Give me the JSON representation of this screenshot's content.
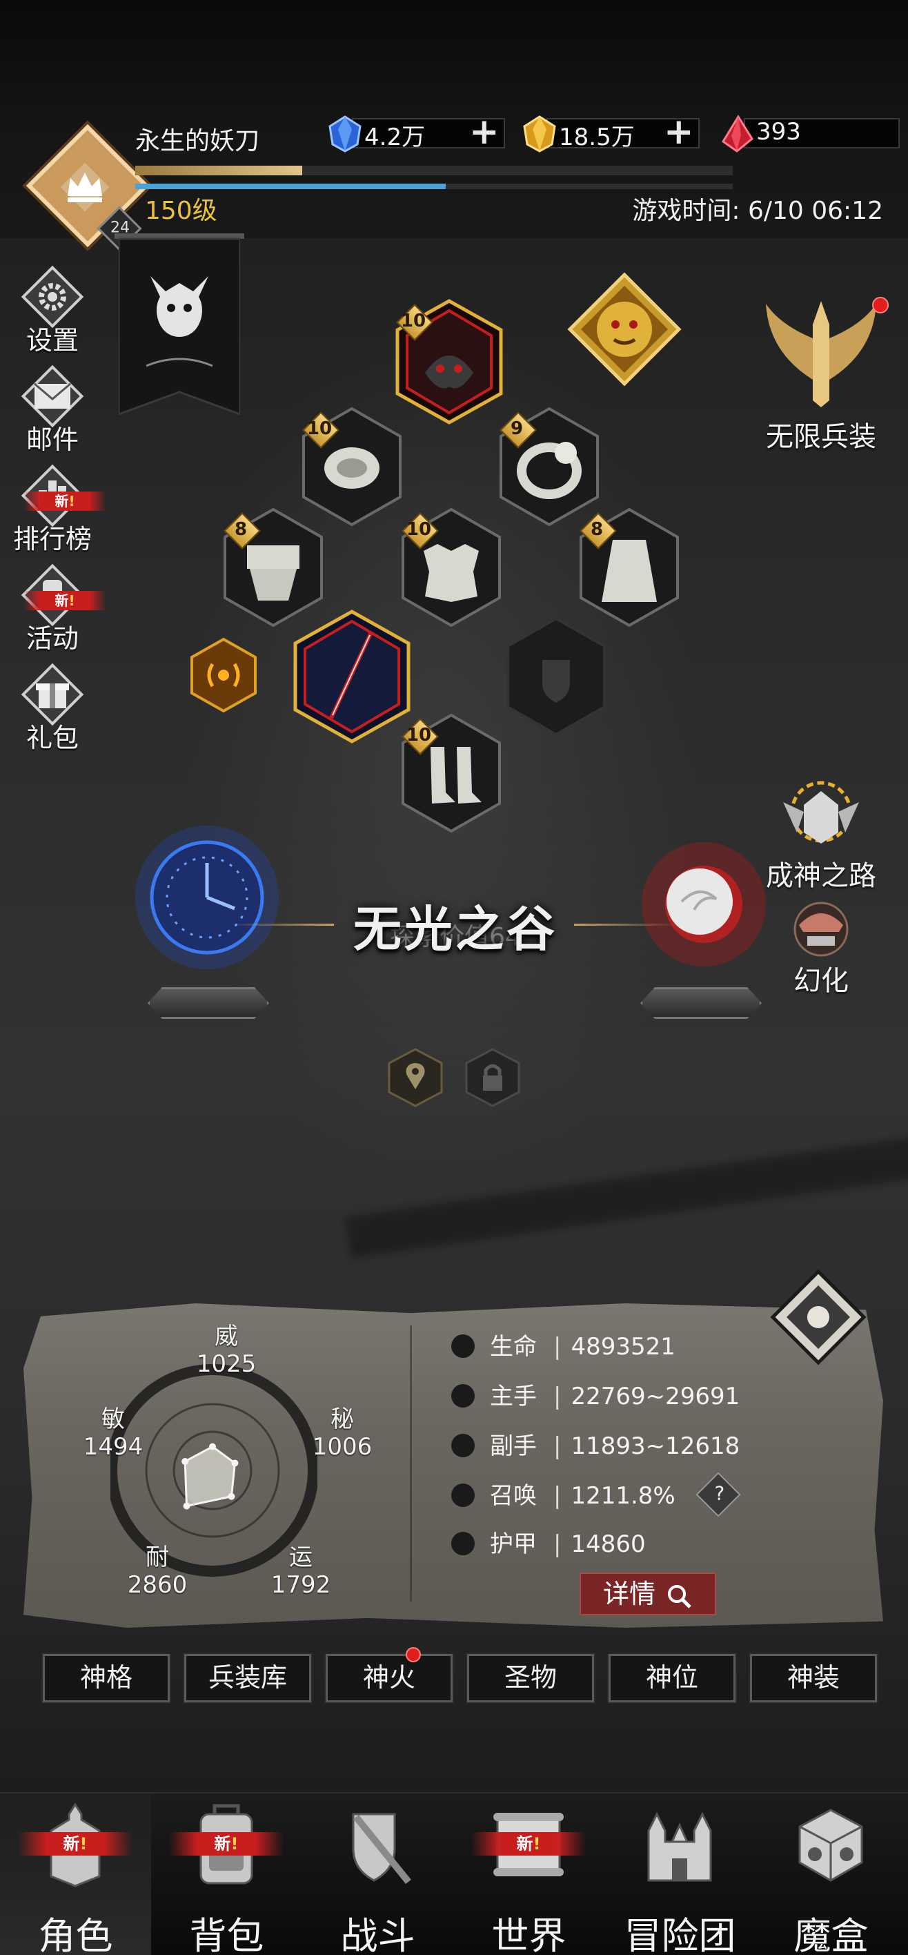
{
  "player": {
    "name": "永生的妖刀",
    "level_text": "150级",
    "badge_level": "24",
    "xp_fraction": 0.28,
    "mp_fraction": 0.52
  },
  "game_time": "游戏时间: 6/10 06:12",
  "currencies": [
    {
      "name": "blue-gem",
      "value": "4.2万",
      "color": "#3a7ee8"
    },
    {
      "name": "gold-gem",
      "value": "18.5万",
      "color": "#e8b32a"
    },
    {
      "name": "red-gem",
      "value": "393",
      "color": "#d8283a"
    }
  ],
  "left_menu": {
    "settings": "设置",
    "mail": "邮件",
    "ranking": "排行榜",
    "events": "活动",
    "gifts": "礼包",
    "new_label": "新",
    "new_mark": "!"
  },
  "equipment": {
    "helmet": "10",
    "necklace": "10",
    "ring": "9",
    "belt": "8",
    "armor": "10",
    "cloak": "8",
    "boots": "10"
  },
  "right_menu": {
    "infinite_arms": "无限兵装",
    "path_to_godhood": "成神之路",
    "transform": "幻化"
  },
  "realm": {
    "title": "无光之谷",
    "subtitle": "探索价值64"
  },
  "radar": {
    "wei": {
      "label": "威",
      "value": "1025"
    },
    "mi": {
      "label": "秘",
      "value": "1006"
    },
    "yun": {
      "label": "运",
      "value": "1792"
    },
    "nai": {
      "label": "耐",
      "value": "2860"
    },
    "min": {
      "label": "敏",
      "value": "1494"
    }
  },
  "stats": [
    {
      "name": "生命",
      "value": "4893521"
    },
    {
      "name": "主手",
      "value": "22769~29691"
    },
    {
      "name": "副手",
      "value": "11893~12618"
    },
    {
      "name": "召唤",
      "value": "1211.8%"
    },
    {
      "name": "护甲",
      "value": "14860"
    }
  ],
  "help_mark": "?",
  "detail_button": "详情",
  "tabs": [
    "神格",
    "兵装库",
    "神火",
    "圣物",
    "神位",
    "神装"
  ],
  "bottom_nav": {
    "items": [
      "角色",
      "背包",
      "战斗",
      "世界",
      "冒险团",
      "魔盒"
    ],
    "new_label": "新",
    "new_mark": "!"
  }
}
